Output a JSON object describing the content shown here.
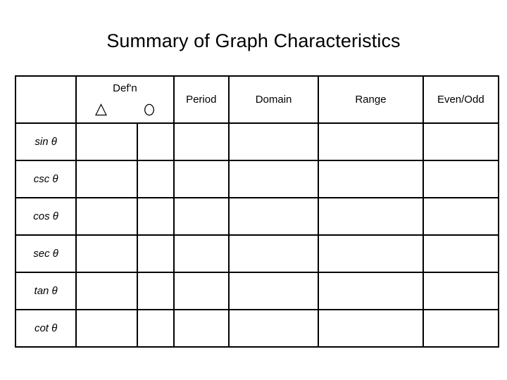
{
  "page": {
    "title": "Summary of Graph Characteristics",
    "background_color": "#ffffff",
    "text_color": "#000000",
    "border_color": "#000000"
  },
  "table": {
    "columns": [
      {
        "key": "function",
        "label": ""
      },
      {
        "key": "defn_triangle",
        "label": ""
      },
      {
        "key": "defn_circle",
        "label": ""
      },
      {
        "key": "period",
        "label": "Period"
      },
      {
        "key": "domain",
        "label": "Domain"
      },
      {
        "key": "range",
        "label": "Range"
      },
      {
        "key": "even_odd",
        "label": "Even/Odd"
      }
    ],
    "group_header": {
      "label": "Def'n",
      "sub_headers": [
        {
          "icon": "triangle-icon",
          "symbol": "Δ"
        },
        {
          "icon": "circle-icon",
          "symbol": "O"
        }
      ]
    },
    "rows": [
      {
        "function": "sin θ",
        "defn_triangle": "",
        "defn_circle": "",
        "period": "",
        "domain": "",
        "range": "",
        "even_odd": ""
      },
      {
        "function": "csc θ",
        "defn_triangle": "",
        "defn_circle": "",
        "period": "",
        "domain": "",
        "range": "",
        "even_odd": ""
      },
      {
        "function": "cos θ",
        "defn_triangle": "",
        "defn_circle": "",
        "period": "",
        "domain": "",
        "range": "",
        "even_odd": ""
      },
      {
        "function": "sec θ",
        "defn_triangle": "",
        "defn_circle": "",
        "period": "",
        "domain": "",
        "range": "",
        "even_odd": ""
      },
      {
        "function": "tan θ",
        "defn_triangle": "",
        "defn_circle": "",
        "period": "",
        "domain": "",
        "range": "",
        "even_odd": ""
      },
      {
        "function": "cot θ",
        "defn_triangle": "",
        "defn_circle": "",
        "period": "",
        "domain": "",
        "range": "",
        "even_odd": ""
      }
    ]
  }
}
